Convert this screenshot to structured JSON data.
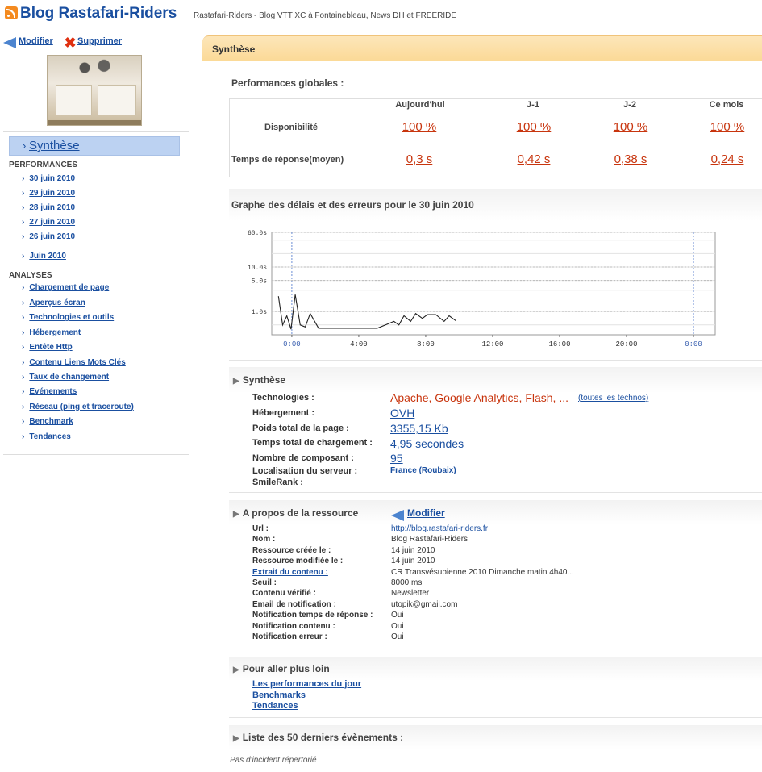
{
  "header": {
    "blog_title": "Blog Rastafari-Riders",
    "blog_description": "Rastafari-Riders - Blog VTT XC à Fontainebleau, News DH et FREERIDE"
  },
  "sidebar": {
    "modify_label": "Modifier",
    "delete_label": "Supprimer",
    "active_item": "Synthèse",
    "performances_heading": "PERFORMANCES",
    "performance_days": [
      "30 juin 2010",
      "29 juin 2010",
      "28 juin 2010",
      "27 juin 2010",
      "26 juin 2010"
    ],
    "performance_month": "Juin 2010",
    "analyses_heading": "ANALYSES",
    "analyses": [
      "Chargement de page",
      "Aperçus écran",
      "Technologies et outils",
      "Hébergement",
      "Entête Http",
      "Contenu Liens Mots Clés",
      "Taux de changement",
      "Evénements",
      "Réseau (ping et traceroute)",
      "Benchmark",
      "Tendances"
    ]
  },
  "main": {
    "title": "Synthèse",
    "perf": {
      "title": "Performances globales :",
      "columns": [
        "Aujourd'hui",
        "J-1",
        "J-2",
        "Ce mois"
      ],
      "availability_label": "Disponibilité",
      "availability": [
        "100 %",
        "100 %",
        "100 %",
        "100 %"
      ],
      "response_label": "Temps de réponse(moyen)",
      "response": [
        "0,3 s",
        "0,42 s",
        "0,38 s",
        "0,24 s"
      ]
    },
    "graph_title": "Graphe des délais et des erreurs pour le 30 juin 2010",
    "synthese": {
      "title": "Synthèse",
      "technologies_label": "Technologies :",
      "technologies_value": "Apache, Google Analytics, Flash, ...",
      "technologies_link": "(toutes les technos)",
      "hosting_label": "Hébergement :",
      "hosting_value": "OVH",
      "weight_label": "Poids total de la page :",
      "weight_value": "3355,15 Kb",
      "load_label": "Temps total de chargement :",
      "load_value": "4,95 secondes",
      "components_label": "Nombre de composant :",
      "components_value": "95",
      "location_label": "Localisation du serveur :",
      "location_value": "France (Roubaix)",
      "smilerank_label": "SmileRank :"
    },
    "resource": {
      "title": "A propos de la ressource",
      "modify_label": "Modifier",
      "rows": [
        {
          "key": "Url :",
          "value": "http://blog.rastafari-riders.fr"
        },
        {
          "key": "Nom :",
          "value": "Blog Rastafari-Riders"
        },
        {
          "key": "Ressource créée le :",
          "value": "14 juin 2010"
        },
        {
          "key": "Ressource modifiée le :",
          "value": "14 juin 2010"
        },
        {
          "key": "Extrait du contenu :",
          "value": "CR Transvésubienne 2010 Dimanche matin 4h40..."
        },
        {
          "key": "Seuil :",
          "value": "8000 ms"
        },
        {
          "key": "Contenu vérifié :",
          "value": "Newsletter"
        },
        {
          "key": "Email de notification :",
          "value": "utopik@gmail.com"
        },
        {
          "key": "Notification temps de réponse :",
          "value": "Oui"
        },
        {
          "key": "Notification contenu :",
          "value": "Oui"
        },
        {
          "key": "Notification erreur :",
          "value": "Oui"
        }
      ]
    },
    "further": {
      "title": "Pour aller plus loin",
      "links": [
        "Les performances du jour",
        "Benchmarks",
        "Tendances"
      ]
    },
    "events": {
      "title": "Liste des 50 derniers évènements :",
      "empty_text": "Pas d'incident répertorié"
    }
  },
  "chart_data": {
    "type": "line",
    "yscale": "log",
    "y_ticks": [
      "60.0s",
      "10.0s",
      "5.0s",
      "1.0s"
    ],
    "x_ticks": [
      "0:00",
      "4:00",
      "8:00",
      "12:00",
      "16:00",
      "20:00",
      "0:00"
    ],
    "series": [
      {
        "points_hours": [
          0.1,
          0.35,
          0.6,
          0.85,
          1.1,
          1.4,
          1.7,
          2.0,
          2.5,
          3.0,
          4.0,
          5.0,
          6.0,
          6.5,
          7.0,
          7.3,
          7.6,
          8.0,
          8.3,
          8.7,
          9.0,
          9.5,
          10.0,
          10.3,
          10.7
        ],
        "values_s": [
          2.2,
          0.5,
          0.8,
          0.4,
          2.4,
          0.5,
          0.45,
          0.9,
          0.42,
          0.42,
          0.42,
          0.42,
          0.42,
          0.5,
          0.6,
          0.5,
          0.8,
          0.6,
          0.9,
          0.7,
          0.85,
          0.85,
          0.6,
          0.8,
          0.62
        ]
      }
    ]
  }
}
